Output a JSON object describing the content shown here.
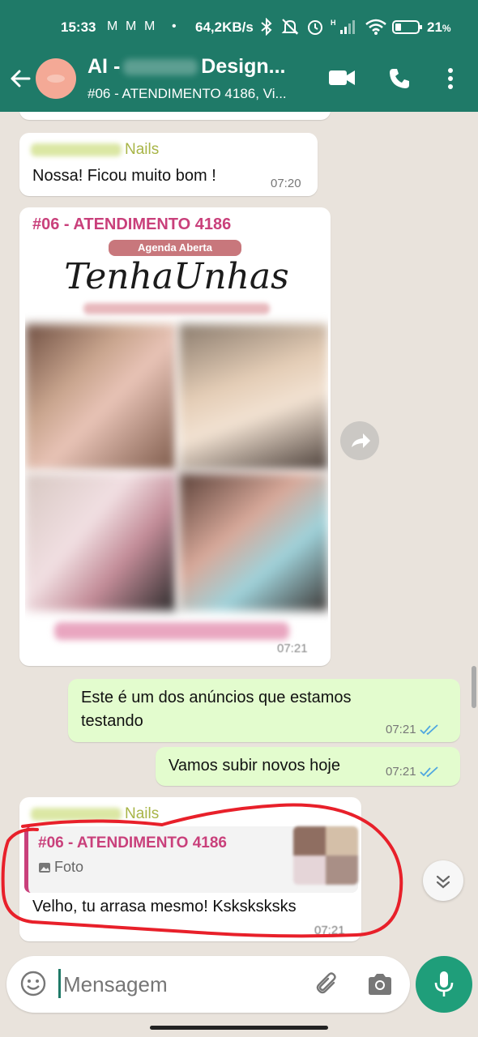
{
  "status_bar": {
    "time": "15:33",
    "notif_icons": [
      "M",
      "M",
      "M",
      "•"
    ],
    "net_speed": "64,2KB/s",
    "battery": "21",
    "battery_unit": "%"
  },
  "header": {
    "title_start": "AI -",
    "title_end": "Design...",
    "subtitle": "#06  - ATENDIMENTO 4186, Vi..."
  },
  "messages": {
    "m1": {
      "sender": "Nails",
      "text": "Nossa! Ficou muito bom !",
      "time": "07:20"
    },
    "m2": {
      "heading": "#06 - ATENDIMENTO 4186",
      "badge": "Agenda Aberta",
      "brand": "TenhaUnhas",
      "time": "07:21"
    },
    "m3": {
      "line1": "Este é um dos anúncios que estamos",
      "line2": "testando",
      "time": "07:21"
    },
    "m4": {
      "text": "Vamos subir novos hoje",
      "time": "07:21"
    },
    "m5": {
      "sender": "Nails",
      "quote_title": "#06 - ATENDIMENTO 4186",
      "quote_type": "Foto",
      "text": "Velho, tu arrasa mesmo! Ksksksksks",
      "time": "07:21"
    }
  },
  "composer": {
    "placeholder": "Mensagem"
  },
  "colors": {
    "header": "#1f7a68",
    "accent": "#c9407b",
    "sender": "#a8b547",
    "outgoing": "#e3fcce",
    "mic": "#1f9e7a",
    "annotation": "#e8202a"
  },
  "icons": [
    "back-arrow-icon",
    "video-call-icon",
    "phone-icon",
    "more-vert-icon",
    "forward-icon",
    "chevron-down-icon",
    "emoji-icon",
    "attach-icon",
    "camera-icon",
    "mic-icon",
    "image-icon",
    "double-check-icon"
  ]
}
